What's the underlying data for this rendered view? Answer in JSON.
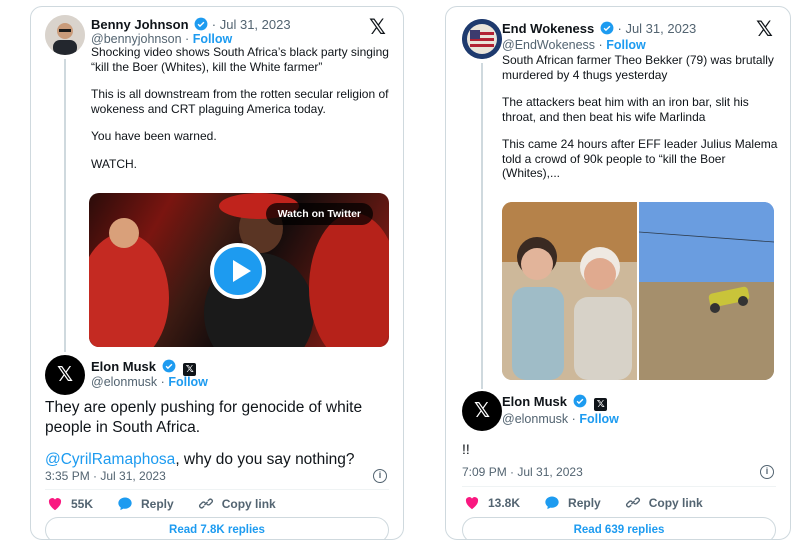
{
  "left_card": {
    "quoted": {
      "name": "Benny Johnson",
      "sep": "·",
      "date": "Jul 31, 2023",
      "handle": "@bennyjohnson",
      "follow": "Follow",
      "paragraphs": [
        "Shocking video shows South Africa’s black party singing “kill the Boer (Whites), kill the White farmer”",
        "This is all downstream from the rotten secular religion of wokeness and CRT plaguing America today.",
        "You have been warned.",
        "WATCH."
      ],
      "video_pill": "Watch on Twitter"
    },
    "reply": {
      "name": "Elon Musk",
      "handle": "@elonmusk",
      "follow": "Follow",
      "text_line": "They are openly pushing for genocide of white people in South Africa.",
      "mention": "@CyrilRamaphosa",
      "text_after_mention": ", why do you say nothing?",
      "timestamp": "3:35 PM · Jul 31, 2023"
    },
    "actions": {
      "likes": "55K",
      "reply": "Reply",
      "copy": "Copy link"
    },
    "replies_button": "Read 7.8K replies"
  },
  "right_card": {
    "quoted": {
      "name": "End Wokeness",
      "sep": "·",
      "date": "Jul 31, 2023",
      "handle": "@EndWokeness",
      "follow": "Follow",
      "paragraphs": [
        "South African farmer Theo Bekker (79) was brutally murdered by 4 thugs yesterday",
        "The attackers beat him with an iron bar, slit his throat, and then beat his wife Marlinda",
        "This came 24 hours after EFF leader Julius Malema told a crowd of 90k people to “kill the Boer (Whites),..."
      ]
    },
    "reply": {
      "name": "Elon Musk",
      "handle": "@elonmusk",
      "follow": "Follow",
      "text": "!!",
      "timestamp": "7:09 PM · Jul 31, 2023"
    },
    "actions": {
      "likes": "13.8K",
      "reply": "Reply",
      "copy": "Copy link"
    },
    "replies_button": "Read 639 replies"
  },
  "icons": {
    "x_logo": "𝕏",
    "info": "i"
  },
  "colors": {
    "accent": "#1d9bf0",
    "like": "#f91880",
    "muted": "#536471",
    "border": "#cfd9de"
  }
}
